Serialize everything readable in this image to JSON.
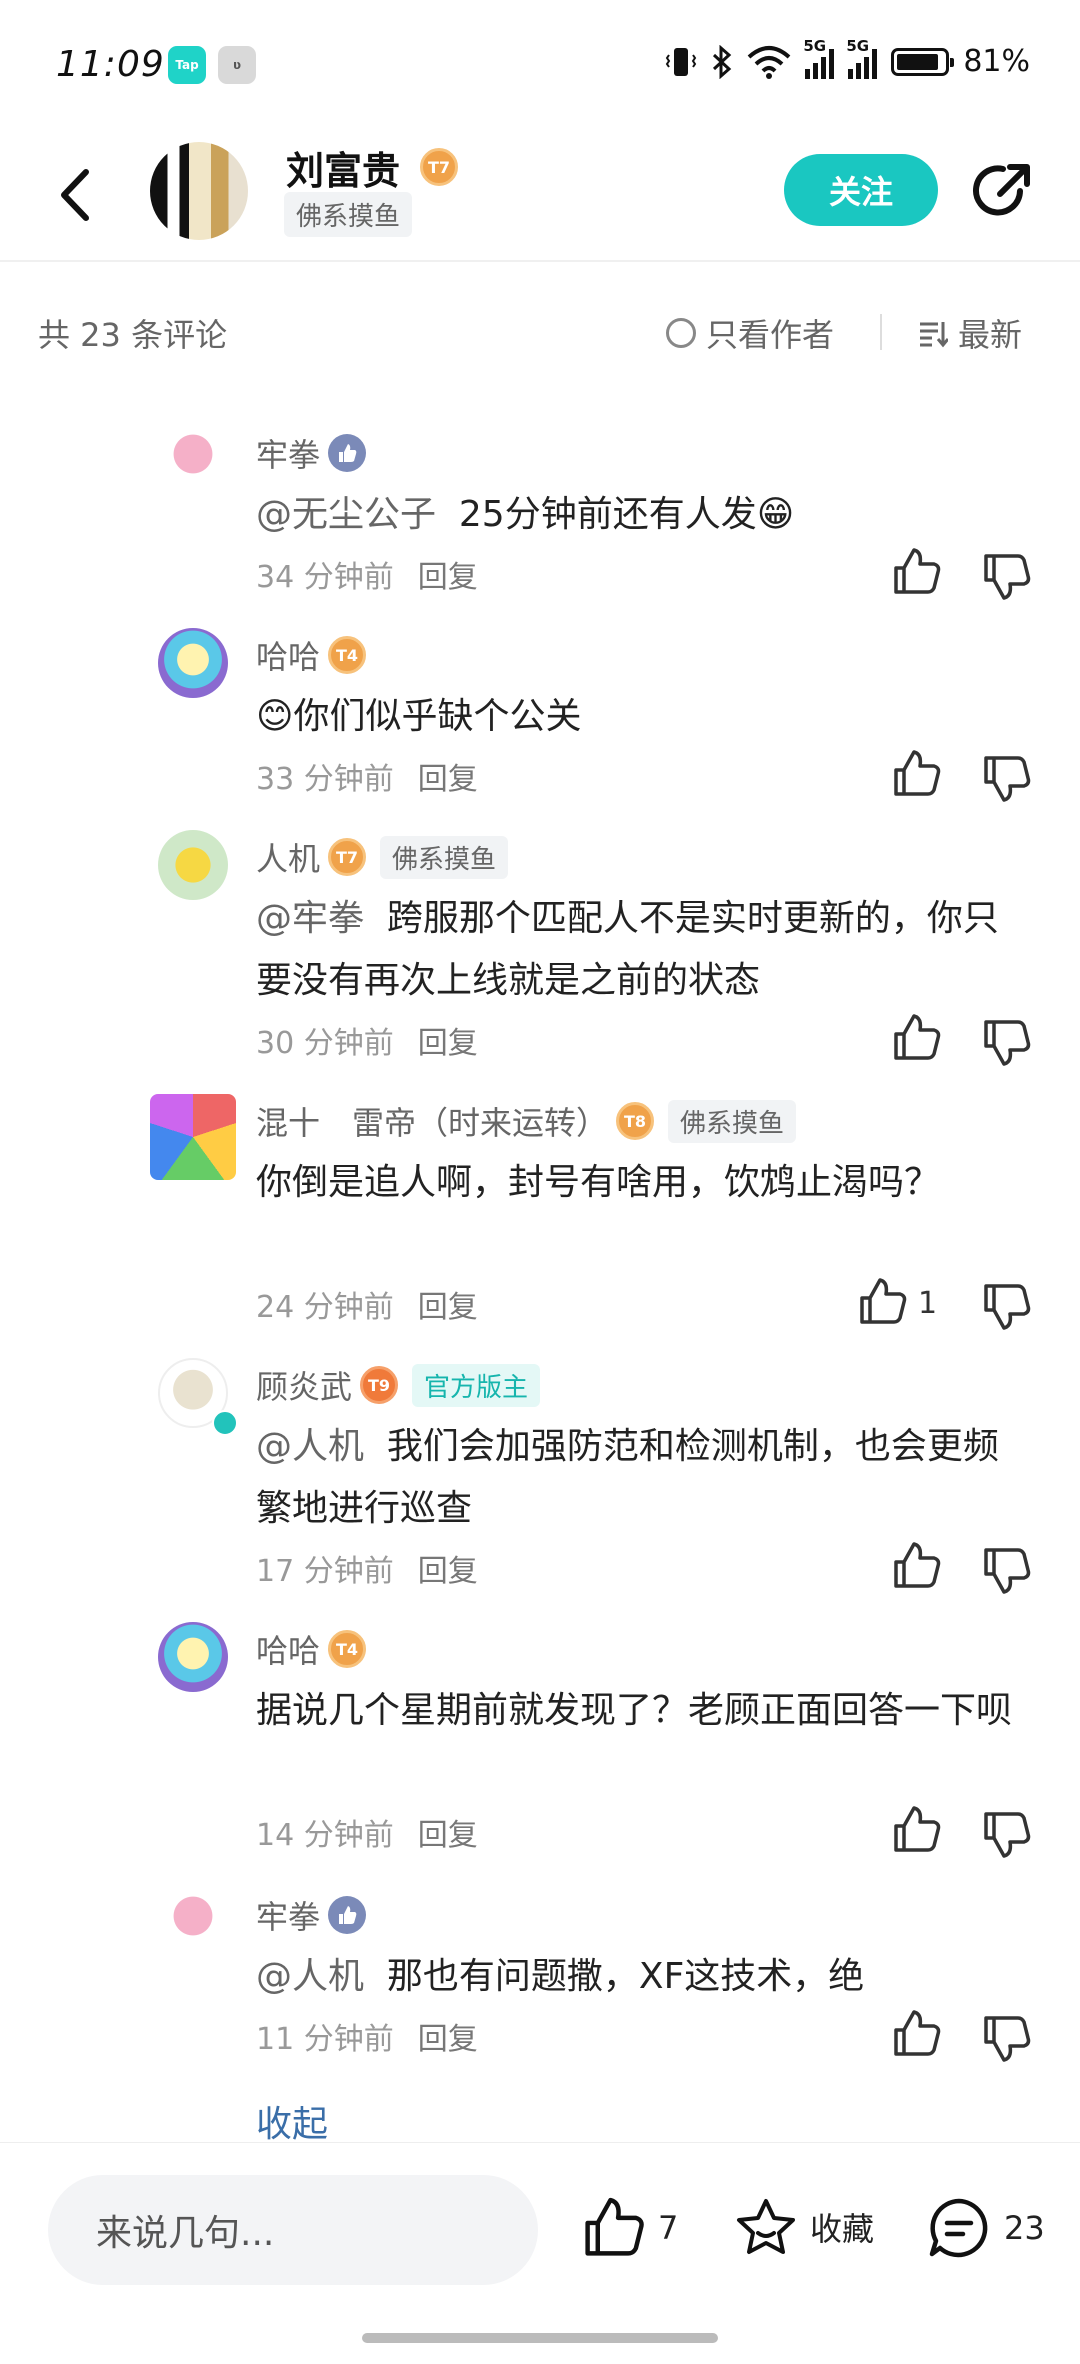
{
  "status_bar": {
    "time": "11:09",
    "app1": "Tap",
    "signal1": "5G",
    "signal2": "5G",
    "battery": "81%"
  },
  "header": {
    "author_name": "刘富贵",
    "author_level": "7",
    "author_tag": "佛系摸鱼",
    "follow_label": "关注"
  },
  "filter": {
    "count_text": "共 23 条评论",
    "only_author": "只看作者",
    "sort": "最新"
  },
  "comments": [
    {
      "user": "牢拳",
      "text_at": "@无尘公子",
      "text": "25分钟前还有人发😁",
      "time": "34 分钟前",
      "reply": "回复"
    },
    {
      "user": "哈哈",
      "level": "4",
      "text": "😊你们似乎缺个公关",
      "time": "33 分钟前",
      "reply": "回复"
    },
    {
      "user": "人机",
      "level": "7",
      "tag": "佛系摸鱼",
      "text_at": "@牢拳",
      "text": "跨服那个匹配人不是实时更新的，你只要没有再次上线就是之前的状态",
      "time": "30 分钟前",
      "reply": "回复"
    },
    {
      "user": "混十　雷帝（时来运转）",
      "level": "8",
      "tag": "佛系摸鱼",
      "text": "你倒是追人啊，封号有啥用，饮鸩止渴吗？",
      "time": "24 分钟前",
      "reply": "回复",
      "likes": "1"
    },
    {
      "user": "顾炎武",
      "level": "9",
      "tag": "官方版主",
      "text_at": "@人机",
      "text": "我们会加强防范和检测机制，也会更频繁地进行巡查",
      "time": "17 分钟前",
      "reply": "回复"
    },
    {
      "user": "哈哈",
      "level": "4",
      "text": "据说几个星期前就发现了？老顾正面回答一下呗",
      "time": "14 分钟前",
      "reply": "回复"
    },
    {
      "user": "牢拳",
      "text_at": "@人机",
      "text": "那也有问题撒，XF这技术，绝",
      "time": "11 分钟前",
      "reply": "回复"
    }
  ],
  "collapse_label": "收起",
  "bottom": {
    "input_placeholder": "来说几句...",
    "like_count": "7",
    "favorite_label": "收藏",
    "comment_count": "23"
  }
}
